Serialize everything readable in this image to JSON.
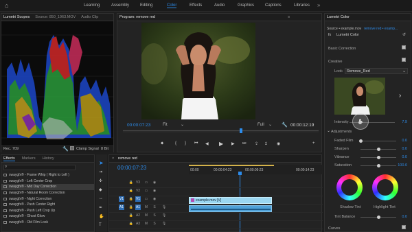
{
  "workspaces": [
    "Learning",
    "Assembly",
    "Editing",
    "Color",
    "Effects",
    "Audio",
    "Graphics",
    "Captions",
    "Libraries"
  ],
  "active_workspace": "Color",
  "scopes": {
    "tabs": [
      "Lumetri Scopes",
      "Source: 850_1963.MOV",
      "Audio Clip"
    ],
    "footer_left": "Rec. 709",
    "clamp_label": "Clamp Signal",
    "bit_label": "8 Bit"
  },
  "program": {
    "title": "Program: remove red",
    "timecode_in": "00:00:07:23",
    "fit": "Fit",
    "quality": "Full",
    "timecode_out": "00:00:12:19"
  },
  "lumetri": {
    "tab": "Lumetri Color",
    "source": "Source • example.mov",
    "sequence": "remove red • examp...",
    "fx_label": "Lumetri Color",
    "basic_correction": "Basic Correction",
    "creative": "Creative",
    "look_label": "Look",
    "look_value": "Remove_Red",
    "intensity_label": "Intensity",
    "intensity_value": "7.9",
    "adjustments": "Adjustments",
    "faded_film": {
      "label": "Faded Film",
      "value": "0.0"
    },
    "sharpen": {
      "label": "Sharpen",
      "value": "0.0"
    },
    "vibrance": {
      "label": "Vibrance",
      "value": "0.0"
    },
    "saturation": {
      "label": "Saturation",
      "value": "100.0"
    },
    "shadow_tint": "Shadow Tint",
    "highlight_tint": "Highlight Tint",
    "tint_balance": {
      "label": "Tint Balance",
      "value": "0.0"
    },
    "curves": "Curves"
  },
  "effects": {
    "tabs": [
      "Effects",
      "Markers",
      "History"
    ],
    "items": [
      "swaygfx® - Frame Whip ( Right to Left )",
      "swaygfx® - Left Center Crop",
      "swaygfx® - Mid Day Correction",
      "swaygfx® - Natural Room Correction",
      "swaygfx® - Night Correction",
      "swaygfx® - Push Center Right",
      "swaygfx® - Push Left Crop Up",
      "swaygfx® - Ghost Glow",
      "swaygfx® - Old Film Look"
    ]
  },
  "timeline": {
    "tab": "remove red",
    "timecode": "00:00:07:23",
    "ruler": [
      "00:00",
      "00:00:04:23",
      "00:00:09:23",
      "00:00:14:23"
    ],
    "tracks": [
      "V3",
      "V2",
      "V1",
      "A1",
      "A2",
      "A3"
    ],
    "src_v": "V1",
    "src_a": "A1",
    "clip_label": "example.mov [V]"
  },
  "colors": {
    "accent": "#2d8ceb",
    "panel": "#232323",
    "clip_video": "#9bd6f0",
    "clip_audio": "#4fa1d8"
  }
}
